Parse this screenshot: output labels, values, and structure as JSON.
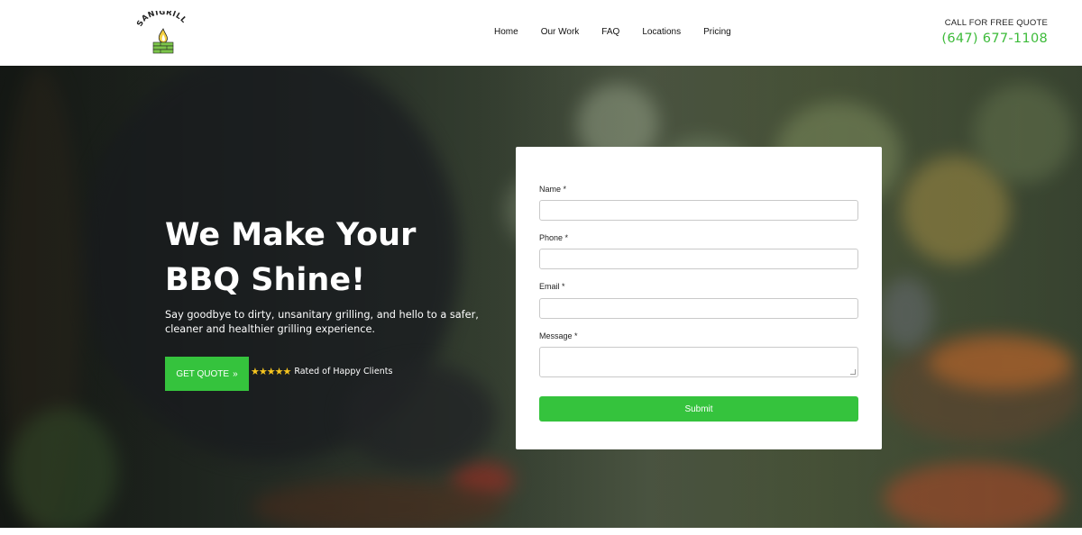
{
  "brand": {
    "logo_text": "SANIGRILL",
    "logo_icon": "flame-grill-icon",
    "accent": "#35c33d"
  },
  "nav": {
    "items": [
      {
        "label": "Home"
      },
      {
        "label": "Our Work"
      },
      {
        "label": "FAQ"
      },
      {
        "label": "Locations"
      },
      {
        "label": "Pricing"
      }
    ]
  },
  "cta": {
    "label": "CALL FOR FREE QUOTE",
    "phone": "(647) 677-1108"
  },
  "hero": {
    "title_line1": "We Make Your",
    "title_line2": "BBQ Shine!",
    "subtitle": "Say goodbye to dirty, unsanitary grilling, and hello to a safer, cleaner and healthier grilling experience.",
    "button_label": "GET QUOTE",
    "button_icon": "double-chevron-right-icon",
    "stars": "★★★★★",
    "rating_text": "Rated of Happy Clients"
  },
  "form": {
    "name_label": "Name *",
    "phone_label": "Phone *",
    "email_label": "Email *",
    "message_label": "Message *",
    "submit_label": "Submit"
  }
}
